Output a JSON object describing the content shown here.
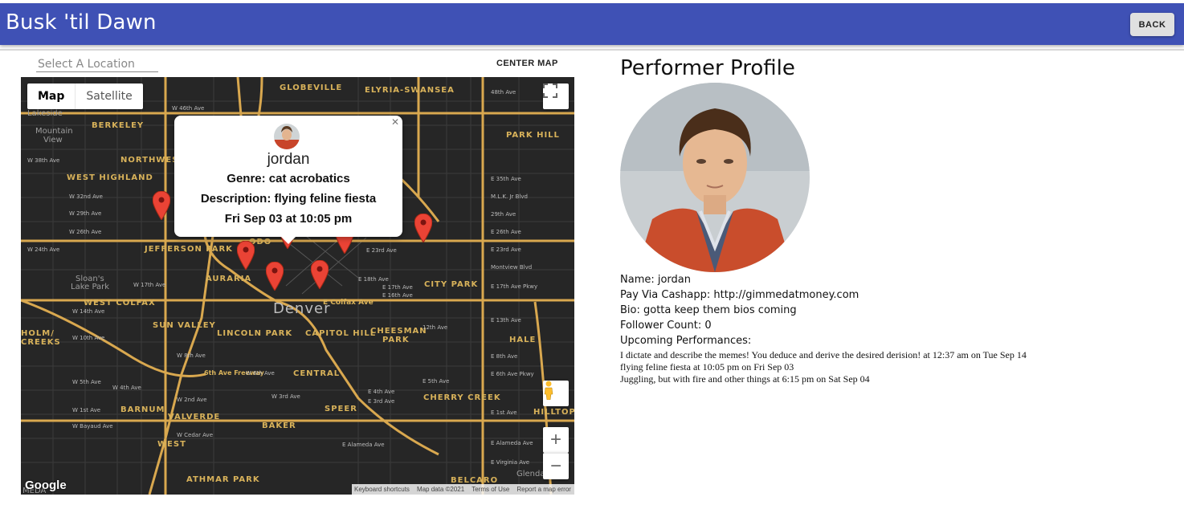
{
  "app": {
    "title": "Busk 'til Dawn",
    "back_label": "BACK"
  },
  "map_panel": {
    "location_placeholder": "Select A Location",
    "center_label": "CENTER MAP",
    "map_types": [
      "Map",
      "Satellite"
    ],
    "city_label": "Denver",
    "neighborhoods": [
      "GLOBEVILLE",
      "ELYRIA-SWANSEA",
      "BERKELEY",
      "PARK HILL",
      "NORTHWEST",
      "WEST HIGHLAND",
      "JEFFERSON PARK",
      "AURARIA",
      "CITY PARK",
      "WEST COLFAX",
      "SUN VALLEY",
      "LINCOLN PARK",
      "CAPITOL HILL",
      "CHEESMAN",
      "PARK",
      "HALE",
      "HOLM/",
      "CREEKS",
      "CENTRAL",
      "CHERRY CREEK",
      "BARNUM",
      "VALVERDE",
      "BAKER",
      "SPEER",
      "HILLTOP",
      "WEST",
      "ATHMAR PARK",
      "BELCARO",
      "ODO"
    ],
    "small_places": [
      "Lakeside",
      "Mountain",
      "View",
      "Sloan's",
      "Lake Park",
      "Glendale",
      "MEDA"
    ],
    "streets": [
      "W 46th Ave",
      "W 38th Ave",
      "W 32nd Ave",
      "W 29th Ave",
      "W 26th Ave",
      "W 24th Ave",
      "W 17th Ave",
      "W 14th Ave",
      "W 10th Ave",
      "W 8th Ave",
      "W 5th Ave",
      "W 4th Ave",
      "W 2nd Ave",
      "W 1st Ave",
      "W Bayaud Ave",
      "W Cedar Ave",
      "E 35th Ave",
      "M.L.K. Jr Blvd",
      "29th Ave",
      "E 26th Ave",
      "E 23rd Ave",
      "Montview Blvd",
      "E 17th Ave Pkwy",
      "E 13th Ave",
      "E 8th Ave",
      "E 6th Ave Pkwy",
      "E 1st Ave",
      "E Alameda Ave",
      "E Virginia Ave",
      "E 23rd Ave",
      "E 18th Ave",
      "E 17th Ave",
      "E 16th Ave",
      "E Colfax Ave",
      "12th Ave",
      "6th Ave Freeway",
      "E 4th Ave",
      "E 3rd Ave",
      "E Alameda Ave",
      "W 6th Ave",
      "W 3rd Ave",
      "E 5th Ave",
      "48th Ave"
    ],
    "info_window": {
      "name": "jordan",
      "genre": "Genre: cat acrobatics",
      "description": "Description: flying feline fiesta",
      "datetime": "Fri Sep 03 at 10:05 pm"
    },
    "markers_count": 7,
    "logo": "Google",
    "attribution": [
      "Keyboard shortcuts",
      "Map data ©2021",
      "Terms of Use",
      "Report a map error"
    ]
  },
  "profile": {
    "title": "Performer Profile",
    "name": "Name: jordan",
    "cashapp": "Pay Via Cashapp: http://gimmedatmoney.com",
    "bio": "Bio: gotta keep them bios coming",
    "followers": "Follower Count: 0",
    "upcoming_label": "Upcoming Performances:",
    "performances": [
      "I dictate and describe the memes! You deduce and derive the desired derision! at 12:37 am on Tue Sep 14",
      "flying feline fiesta at 10:05 pm on Fri Sep 03",
      "Juggling, but with fire and other things at 6:15 pm on Sat Sep 04"
    ]
  },
  "colors": {
    "appbar": "#3f51b5",
    "map_bg": "#262626",
    "road": "#e8b85c",
    "marker": "#ea4335"
  }
}
